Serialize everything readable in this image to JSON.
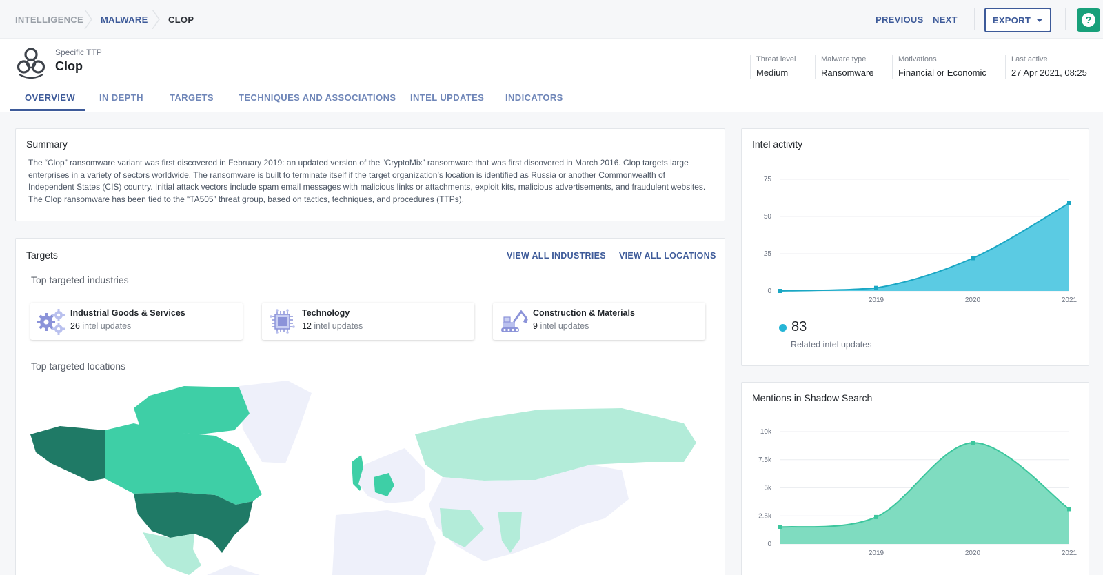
{
  "breadcrumb": [
    "INTELLIGENCE",
    "MALWARE",
    "CLOP"
  ],
  "nav": {
    "previous": "PREVIOUS",
    "next": "NEXT",
    "export": "EXPORT",
    "help": "?"
  },
  "entity": {
    "subtitle": "Specific TTP",
    "title": "Clop"
  },
  "meta": [
    {
      "label": "Threat level",
      "value": "Medium"
    },
    {
      "label": "Malware type",
      "value": "Ransomware"
    },
    {
      "label": "Motivations",
      "value": "Financial or Economic"
    },
    {
      "label": "Last active",
      "value": "27 Apr 2021, 08:25"
    }
  ],
  "tabs": [
    "OVERVIEW",
    "IN DEPTH",
    "TARGETS",
    "TECHNIQUES AND ASSOCIATIONS",
    "INTEL UPDATES",
    "INDICATORS"
  ],
  "summary": {
    "title": "Summary",
    "text": "The “Clop” ransomware variant was first discovered in February 2019: an updated version of the “CryptoMix” ransomware that was first discovered in March 2016. Clop targets large enterprises in a variety of sectors worldwide. The ransomware is built to terminate itself if the target organization’s location is identified as Russia or another Commonwealth of Independent States (CIS) country. Initial attack vectors include spam email messages with malicious links or attachments, exploit kits, malicious advertisements, and fraudulent websites. The Clop ransomware has been tied to the “TA505” threat group, based on tactics, techniques, and procedures (TTPs)."
  },
  "targets": {
    "title": "Targets",
    "view_industries": "VIEW ALL INDUSTRIES",
    "view_locations": "VIEW ALL LOCATIONS",
    "industries_title": "Top targeted industries",
    "locations_title": "Top targeted locations",
    "industries": [
      {
        "name": "Industrial Goods & Services",
        "count": "26",
        "unit": "intel updates",
        "icon": "gears-icon"
      },
      {
        "name": "Technology",
        "count": "12",
        "unit": "intel updates",
        "icon": "chip-icon"
      },
      {
        "name": "Construction & Materials",
        "count": "9",
        "unit": "intel updates",
        "icon": "excavator-icon"
      }
    ]
  },
  "colors": {
    "accent": "#3d5a99",
    "teal_dark": "#1f7a66",
    "teal_mid": "#3ecfa6",
    "teal_light": "#b3ecd9",
    "map_base": "#eef0fa",
    "intel_fill": "#5bcbe3",
    "shadow_fill": "#7fdcc0"
  },
  "intel_activity": {
    "title": "Intel activity",
    "total": "83",
    "total_label": "Related intel updates",
    "chart_data": {
      "type": "area",
      "x": [
        2018.0,
        2019.0,
        2020.0,
        2021.0
      ],
      "x_ticks": [
        "2019",
        "2020",
        "2021"
      ],
      "y": [
        0,
        2,
        22,
        59
      ],
      "y_ticks": [
        "0",
        "25",
        "50",
        "75"
      ],
      "ylim": [
        0,
        75
      ]
    }
  },
  "shadow_search": {
    "title": "Mentions in Shadow Search",
    "chart_data": {
      "type": "area",
      "x": [
        2018.0,
        2019.0,
        2020.0,
        2021.0
      ],
      "x_ticks": [
        "2019",
        "2020",
        "2021"
      ],
      "y": [
        1500,
        2400,
        9000,
        3100
      ],
      "y_ticks": [
        "0",
        "2.5k",
        "5k",
        "7.5k",
        "10k"
      ],
      "ylim": [
        0,
        10000
      ]
    }
  }
}
